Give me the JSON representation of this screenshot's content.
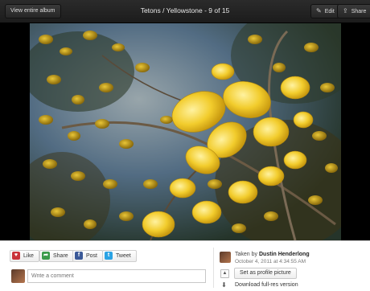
{
  "topbar": {
    "view_album": "View entire album",
    "title": "Tetons / Yellowstone - 9 of 15",
    "edit": "Edit",
    "share": "Share"
  },
  "social": {
    "like": "Like",
    "share": "Share",
    "post": "Post",
    "tweet": "Tweet",
    "post_icon": "f",
    "tweet_icon": "t"
  },
  "comment": {
    "placeholder": "Write a comment"
  },
  "info": {
    "taken_prefix": "Taken by",
    "owner": "Dustin Henderlong",
    "date": "October 4, 2011 at 4:34:55 AM"
  },
  "actions": {
    "set_profile": "Set as profile picture",
    "download": "Download full-res version"
  },
  "photo": {
    "subject": "yellow aspen leaves against blue sky"
  }
}
